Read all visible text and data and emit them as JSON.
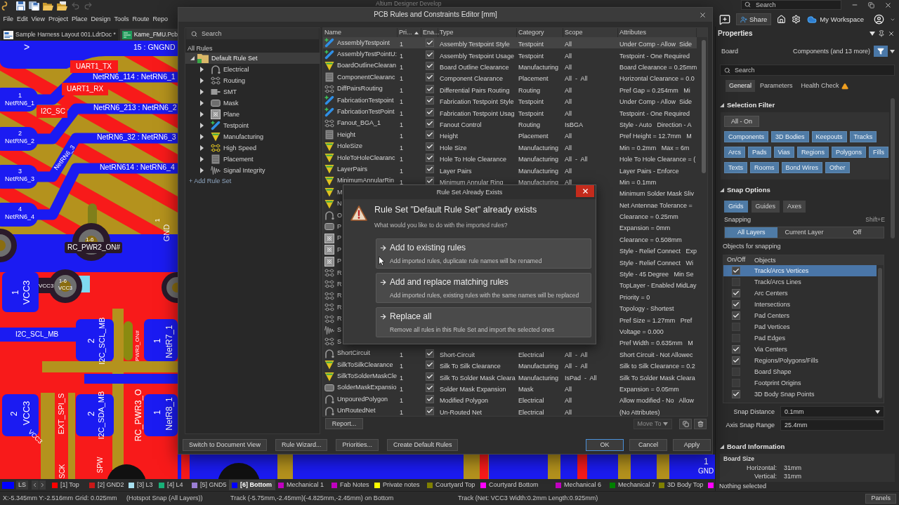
{
  "app": {
    "title": "Altium Designer Develop",
    "search_placeholder": "Search"
  },
  "quick_access": [
    {
      "kind": "save",
      "disabled": false
    },
    {
      "kind": "save_all",
      "disabled": false
    },
    {
      "kind": "open",
      "disabled": false
    },
    {
      "kind": "open_project",
      "disabled": false
    },
    {
      "kind": "undo",
      "disabled": true
    },
    {
      "kind": "redo",
      "disabled": true
    }
  ],
  "menu": [
    "File",
    "Edit",
    "View",
    "Project",
    "Place",
    "Design",
    "Tools",
    "Route",
    "Repo"
  ],
  "header_actions": {
    "share": "Share",
    "workspace": "My Workspace"
  },
  "document_tabs": [
    {
      "kind": "harness",
      "label": "Sample Harness Layout 001.LdrDoc *",
      "selected": false
    },
    {
      "kind": "pcb",
      "label": "Kame_FMU.Pcb",
      "selected": true
    }
  ],
  "pcb": {
    "labels": [
      ">",
      "15 : GNGND",
      "UART1_TX",
      "NetRN6_114 : NetRN6_1",
      "UART1_RX",
      "1",
      "NetRN6_1",
      "I2C_SC",
      "NetRN6_213 : NetRN6_2",
      "2",
      "NetRN6_2",
      "NetRN6_32 : NetRN6_3",
      "NetRN6_3",
      "NetRN614 : NetRN6_4",
      "3",
      "NetRN6_3",
      "4",
      "NetRN6_4",
      "1",
      "GND",
      "1-6",
      "RC_PWR2_ON#",
      "1",
      "VCC3",
      "VCC3",
      "1-6",
      "VCC3",
      "I2C_SCL_MB",
      "2",
      "I2C_SCL_MB",
      "PWR3_ON#",
      "1",
      "NetR7_1",
      "EXT_SPI_S",
      "2",
      "VCC3",
      "VCC3",
      "2",
      "I2C_SDA_MB",
      "RC_PWR3_O",
      "1",
      "NetR8_1",
      "SCK",
      "SPW",
      "1",
      "GND"
    ]
  },
  "rules_editor": {
    "title": "PCB Rules and Constraints Editor [mm]",
    "search_placeholder": "Search",
    "tree": {
      "root": "All Rules",
      "rule_set": {
        "label": "Default Rule Set",
        "expanded": true,
        "selected": true,
        "children": [
          {
            "kind": "electrical",
            "label": "Electrical",
            "expanded": false,
            "selected": false
          },
          {
            "kind": "routing",
            "label": "Routing",
            "expanded": false,
            "selected": false
          },
          {
            "kind": "smt",
            "label": "SMT",
            "expanded": false,
            "selected": false
          },
          {
            "kind": "mask",
            "label": "Mask",
            "expanded": false,
            "selected": false
          },
          {
            "kind": "plane",
            "label": "Plane",
            "expanded": false,
            "selected": false
          },
          {
            "kind": "testpoint",
            "label": "Testpoint",
            "expanded": false,
            "selected": false
          },
          {
            "kind": "manufacturing",
            "label": "Manufacturing",
            "expanded": false,
            "selected": false
          },
          {
            "kind": "high_speed",
            "label": "High Speed",
            "expanded": false,
            "selected": false
          },
          {
            "kind": "placement",
            "label": "Placement",
            "expanded": false,
            "selected": false
          },
          {
            "kind": "signal",
            "label": "Signal Integrity",
            "expanded": false,
            "selected": false
          }
        ]
      }
    },
    "add_rule_set": "+ Add Rule Set",
    "columns": [
      {
        "label": "Name",
        "sorted": false
      },
      {
        "label": "Pri...",
        "sorted": true
      },
      {
        "label": "Ena...",
        "sorted": false
      },
      {
        "label": "Type",
        "sorted": false
      },
      {
        "label": "Category",
        "sorted": false
      },
      {
        "label": "Scope",
        "sorted": false
      },
      {
        "label": "Attributes",
        "sorted": false
      }
    ],
    "rows": [
      {
        "kind": "testpoint",
        "name": "AssemblyTestpoint",
        "priority": "1",
        "enabled": true,
        "type": "Assembly Testpoint Style",
        "category": "Testpoint",
        "scope": "All",
        "attributes": "Under Comp - Allow  Side",
        "selected": true
      },
      {
        "kind": "testpoint",
        "name": "AssemblyTestPointU:",
        "priority": "1",
        "enabled": true,
        "type": "Assembly Testpoint Usage",
        "category": "Testpoint",
        "scope": "All",
        "attributes": "Testpoint - One Required",
        "selected": false
      },
      {
        "kind": "manufacturing",
        "name": "BoardOutlineClearan",
        "priority": "1",
        "enabled": true,
        "type": "Board Outline Clearance",
        "category": "Manufacturing",
        "scope": "All",
        "attributes": "Board Clearance = 0.25mm",
        "selected": false
      },
      {
        "kind": "placement",
        "name": "ComponentClearanc",
        "priority": "1",
        "enabled": true,
        "type": "Component Clearance",
        "category": "Placement",
        "scope": "All  -  All",
        "attributes": "Horizontal Clearance = 0.0",
        "selected": false
      },
      {
        "kind": "routing",
        "name": "DiffPairsRouting",
        "priority": "1",
        "enabled": true,
        "type": "Differential Pairs Routing",
        "category": "Routing",
        "scope": "All",
        "attributes": "Pref Gap = 0.254mm   Mi",
        "selected": false
      },
      {
        "kind": "testpoint",
        "name": "FabricationTestpoint",
        "priority": "1",
        "enabled": true,
        "type": "Fabrication Testpoint Style",
        "category": "Testpoint",
        "scope": "All",
        "attributes": "Under Comp - Allow  Side",
        "selected": false
      },
      {
        "kind": "testpoint",
        "name": "FabricationTestPoint",
        "priority": "1",
        "enabled": true,
        "type": "Fabrication Testpoint Usag",
        "category": "Testpoint",
        "scope": "All",
        "attributes": "Testpoint - One Required",
        "selected": false
      },
      {
        "kind": "routing",
        "name": "Fanout_BGA_1",
        "priority": "1",
        "enabled": true,
        "type": "Fanout Control",
        "category": "Routing",
        "scope": "IsBGA",
        "attributes": "Style - Auto   Direction - A",
        "selected": false
      },
      {
        "kind": "placement",
        "name": "Height",
        "priority": "1",
        "enabled": true,
        "type": "Height",
        "category": "Placement",
        "scope": "All",
        "attributes": "Pref Height = 12.7mm   M",
        "selected": false
      },
      {
        "kind": "manufacturing",
        "name": "HoleSize",
        "priority": "1",
        "enabled": true,
        "type": "Hole Size",
        "category": "Manufacturing",
        "scope": "All",
        "attributes": "Min = 0.2mm   Max = 6m",
        "selected": false
      },
      {
        "kind": "manufacturing",
        "name": "HoleToHoleClearanc",
        "priority": "1",
        "enabled": true,
        "type": "Hole To Hole Clearance",
        "category": "Manufacturing",
        "scope": "All  -  All",
        "attributes": "Hole To Hole Clearance = (",
        "selected": false
      },
      {
        "kind": "manufacturing",
        "name": "LayerPairs",
        "priority": "1",
        "enabled": true,
        "type": "Layer Pairs",
        "category": "Manufacturing",
        "scope": "All",
        "attributes": "Layer Pairs - Enforce",
        "selected": false
      },
      {
        "kind": "manufacturing",
        "name": "MinimumAnnularRin",
        "priority": "1",
        "enabled": true,
        "type": "Minimum Annular Ring",
        "category": "Manufacturing",
        "scope": "All",
        "attributes": "Min = 0.1mm",
        "selected": false
      },
      {
        "kind": "manufacturing",
        "name": "M",
        "attributes": "Minimum Solder Mask Sliv",
        "selected": false
      },
      {
        "kind": "manufacturing",
        "name": "N",
        "attributes": "Net Antennae Tolerance =",
        "selected": false
      },
      {
        "kind": "electrical",
        "name": "O",
        "attributes": "Clearance = 0.25mm",
        "selected": false
      },
      {
        "kind": "mask",
        "name": "P",
        "attributes": "Expansion = 0mm",
        "selected": false
      },
      {
        "kind": "plane",
        "name": "P",
        "attributes": "Clearance = 0.508mm",
        "selected": false
      },
      {
        "kind": "plane",
        "name": "P",
        "attributes": "Style - Relief Connect   Exp",
        "selected": false
      },
      {
        "kind": "plane",
        "name": "P",
        "attributes": "Style - Relief Connect   Wi",
        "selected": false
      },
      {
        "kind": "routing",
        "name": "R",
        "attributes": "Style - 45 Degree   Min Se",
        "selected": false
      },
      {
        "kind": "routing",
        "name": "R",
        "attributes": "TopLayer - Enabled MidLay",
        "selected": false
      },
      {
        "kind": "routing",
        "name": "R",
        "attributes": "Priority = 0",
        "selected": false
      },
      {
        "kind": "routing",
        "name": "R",
        "attributes": "Topology - Shortest",
        "selected": false
      },
      {
        "kind": "routing",
        "name": "R",
        "attributes": "Pref Size = 1.27mm   Pref",
        "selected": false
      },
      {
        "kind": "signal",
        "name": "S",
        "attributes": "Voltage = 0.000",
        "selected": false
      },
      {
        "kind": "routing",
        "name": "S",
        "attributes": "Pref Width = 0.635mm   M",
        "selected": false
      },
      {
        "kind": "electrical",
        "name": "ShortCircuit",
        "priority": "1",
        "enabled": true,
        "type": "Short-Circuit",
        "category": "Electrical",
        "scope": "All  -  All",
        "attributes": "Short Circuit - Not Allowec",
        "selected": false
      },
      {
        "kind": "manufacturing",
        "name": "SilkToSilkClearance",
        "priority": "1",
        "enabled": true,
        "type": "Silk To Silk Clearance",
        "category": "Manufacturing",
        "scope": "All  -  All",
        "attributes": "Silk to Silk Clearance = 0.2",
        "selected": false
      },
      {
        "kind": "manufacturing",
        "name": "SilkToSolderMaskCle",
        "priority": "1",
        "enabled": true,
        "type": "Silk To Solder Mask Cleara",
        "category": "Manufacturing",
        "scope": "IsPad  -  All",
        "attributes": "Silk To Solder Mask Cleara",
        "selected": false
      },
      {
        "kind": "mask",
        "name": "SolderMaskExpansio",
        "priority": "1",
        "enabled": true,
        "type": "Solder Mask Expansion",
        "category": "Mask",
        "scope": "All",
        "attributes": "Expansion = 0.05mm",
        "selected": false
      },
      {
        "kind": "electrical",
        "name": "UnpouredPolygon",
        "priority": "1",
        "enabled": true,
        "type": "Modified Polygon",
        "category": "Electrical",
        "scope": "All",
        "attributes": "Allow modified - No   Allow",
        "selected": false
      },
      {
        "kind": "electrical",
        "name": "UnRoutedNet",
        "priority": "1",
        "enabled": true,
        "type": "Un-Routed Net",
        "category": "Electrical",
        "scope": "All",
        "attributes": "(No Attributes)",
        "selected": false
      }
    ],
    "report_button": "Report...",
    "move_to": {
      "label": "Move To",
      "disabled": true
    },
    "footer_left": [
      "Switch to Document View",
      "Rule Wizard...",
      "Priorities...",
      "Create Default Rules"
    ],
    "footer_right": [
      {
        "label": "OK",
        "default": true
      },
      {
        "label": "Cancel",
        "default": false
      },
      {
        "label": "Apply",
        "default": false
      }
    ]
  },
  "dialog": {
    "title": "Rule Set Already Exists",
    "heading": "Rule Set \"Default Rule Set\" already exists",
    "question": "What would you like to do with the imported rules?",
    "options": [
      {
        "title": "Add to existing rules",
        "description": "Add imported rules, duplicate rule names will be renamed"
      },
      {
        "title": "Add and replace matching rules",
        "description": "Add imported rules, existing rules with the same names will be replaced"
      },
      {
        "title": "Replace all",
        "description": "Remove all rules in this Rule Set and import the selected ones"
      }
    ]
  },
  "properties": {
    "title": "Properties",
    "object": "Board",
    "filter_summary": "Components (and 13 more)",
    "search_placeholder": "Search",
    "tabs": [
      {
        "label": "General",
        "selected": true,
        "warning": false
      },
      {
        "label": "Parameters",
        "selected": false,
        "warning": false
      },
      {
        "label": "Health Check",
        "selected": false,
        "warning": true
      }
    ],
    "selection_filter": {
      "title": "Selection Filter",
      "expanded": true,
      "all_button": "All - On",
      "items": [
        {
          "label": "Components",
          "on": true
        },
        {
          "label": "3D Bodies",
          "on": true
        },
        {
          "label": "Keepouts",
          "on": true
        },
        {
          "label": "Tracks",
          "on": true
        },
        {
          "label": "Arcs",
          "on": true
        },
        {
          "label": "Pads",
          "on": true
        },
        {
          "label": "Vias",
          "on": true
        },
        {
          "label": "Regions",
          "on": true
        },
        {
          "label": "Polygons",
          "on": true
        },
        {
          "label": "Fills",
          "on": true
        },
        {
          "label": "Texts",
          "on": true
        },
        {
          "label": "Rooms",
          "on": true
        },
        {
          "label": "Bond Wires",
          "on": true
        },
        {
          "label": "Other",
          "on": true
        }
      ]
    },
    "snap_options": {
      "title": "Snap Options",
      "expanded": true,
      "guides": [
        {
          "label": "Grids",
          "on": true
        },
        {
          "label": "Guides",
          "on": false
        },
        {
          "label": "Axes",
          "on": false
        }
      ],
      "snapping_label": "Snapping",
      "shortcut": "Shift+E",
      "modes": [
        {
          "label": "All Layers",
          "selected": true
        },
        {
          "label": "Current Layer",
          "selected": false
        },
        {
          "label": "Off",
          "selected": false
        }
      ],
      "objects_title": "Objects for snapping",
      "objects_columns": [
        "On/Off",
        "Objects"
      ],
      "objects": [
        {
          "label": "Track/Arcs Vertices",
          "checked": true,
          "selected": true
        },
        {
          "label": "Track/Arcs Lines",
          "checked": false,
          "selected": false
        },
        {
          "label": "Arc Centers",
          "checked": true,
          "selected": false
        },
        {
          "label": "Intersections",
          "checked": true,
          "selected": false
        },
        {
          "label": "Pad Centers",
          "checked": true,
          "selected": false
        },
        {
          "label": "Pad Vertices",
          "checked": false,
          "selected": false
        },
        {
          "label": "Pad Edges",
          "checked": false,
          "selected": false
        },
        {
          "label": "Via Centers",
          "checked": true,
          "selected": false
        },
        {
          "label": "Regions/Polygons/Fills",
          "checked": true,
          "selected": false
        },
        {
          "label": "Board Shape",
          "checked": false,
          "selected": false
        },
        {
          "label": "Footprint Origins",
          "checked": false,
          "selected": false
        },
        {
          "label": "3D Body Snap Points",
          "checked": true,
          "selected": false
        }
      ],
      "snap_distance": {
        "label": "Snap Distance",
        "value": "0.1mm"
      },
      "axis_snap_range": {
        "label": "Axis Snap Range",
        "value": "25.4mm"
      }
    },
    "board_information": {
      "title": "Board Information",
      "expanded": true,
      "group": "Board Size",
      "rows": [
        {
          "label": "Horizontal:",
          "value": "31mm"
        },
        {
          "label": "Vertical:",
          "value": "31mm"
        }
      ]
    },
    "selection_status": "Nothing selected"
  },
  "layer_bar": {
    "layer_set": {
      "label": "LS",
      "color": "#0000ff"
    },
    "layers": [
      {
        "label": "[1] Top",
        "color": "#ff0000",
        "selected": false
      },
      {
        "label": "[2] GND2",
        "color": "#c81818",
        "selected": false
      },
      {
        "label": "[3] L3",
        "color": "#a8e0f0",
        "selected": false
      },
      {
        "label": "[4] L4",
        "color": "#18b078",
        "selected": false
      },
      {
        "label": "[5] GND5",
        "color": "#9b7fd4",
        "selected": false
      },
      {
        "label": "[6] Bottom",
        "color": "#0000ff",
        "selected": true
      },
      {
        "label": "Mechanical 1",
        "color": "#c000c0",
        "selected": false
      },
      {
        "label": "Fab Notes",
        "color": "#c000c0",
        "selected": false
      },
      {
        "label": "Private notes",
        "color": "#ffff00",
        "selected": false
      },
      {
        "label": "Courtyard Top",
        "color": "#808000",
        "selected": false
      },
      {
        "label": "Courtyard Bottom",
        "color": "#ff00ff",
        "selected": false
      },
      {
        "label": "Mechanical 6",
        "color": "#c000c0",
        "selected": false
      },
      {
        "label": "Mechanical 7",
        "color": "#008000",
        "selected": false
      },
      {
        "label": "3D Body Top",
        "color": "#808000",
        "selected": false
      },
      {
        "color": "#ff00ff",
        "selected": false
      }
    ]
  },
  "status_bar": {
    "items": [
      "X:-5.345mm Y:-2.516mm",
      "Grid: 0.025mm",
      "(Hotspot Snap (All Layers))",
      "Track (-5.75mm,-2.45mm)(-4.825mm,-2.45mm) on Bottom",
      "Track (Net: VCC3 Width:0.2mm Length:0.925mm)"
    ],
    "panels_button": "Panels"
  }
}
